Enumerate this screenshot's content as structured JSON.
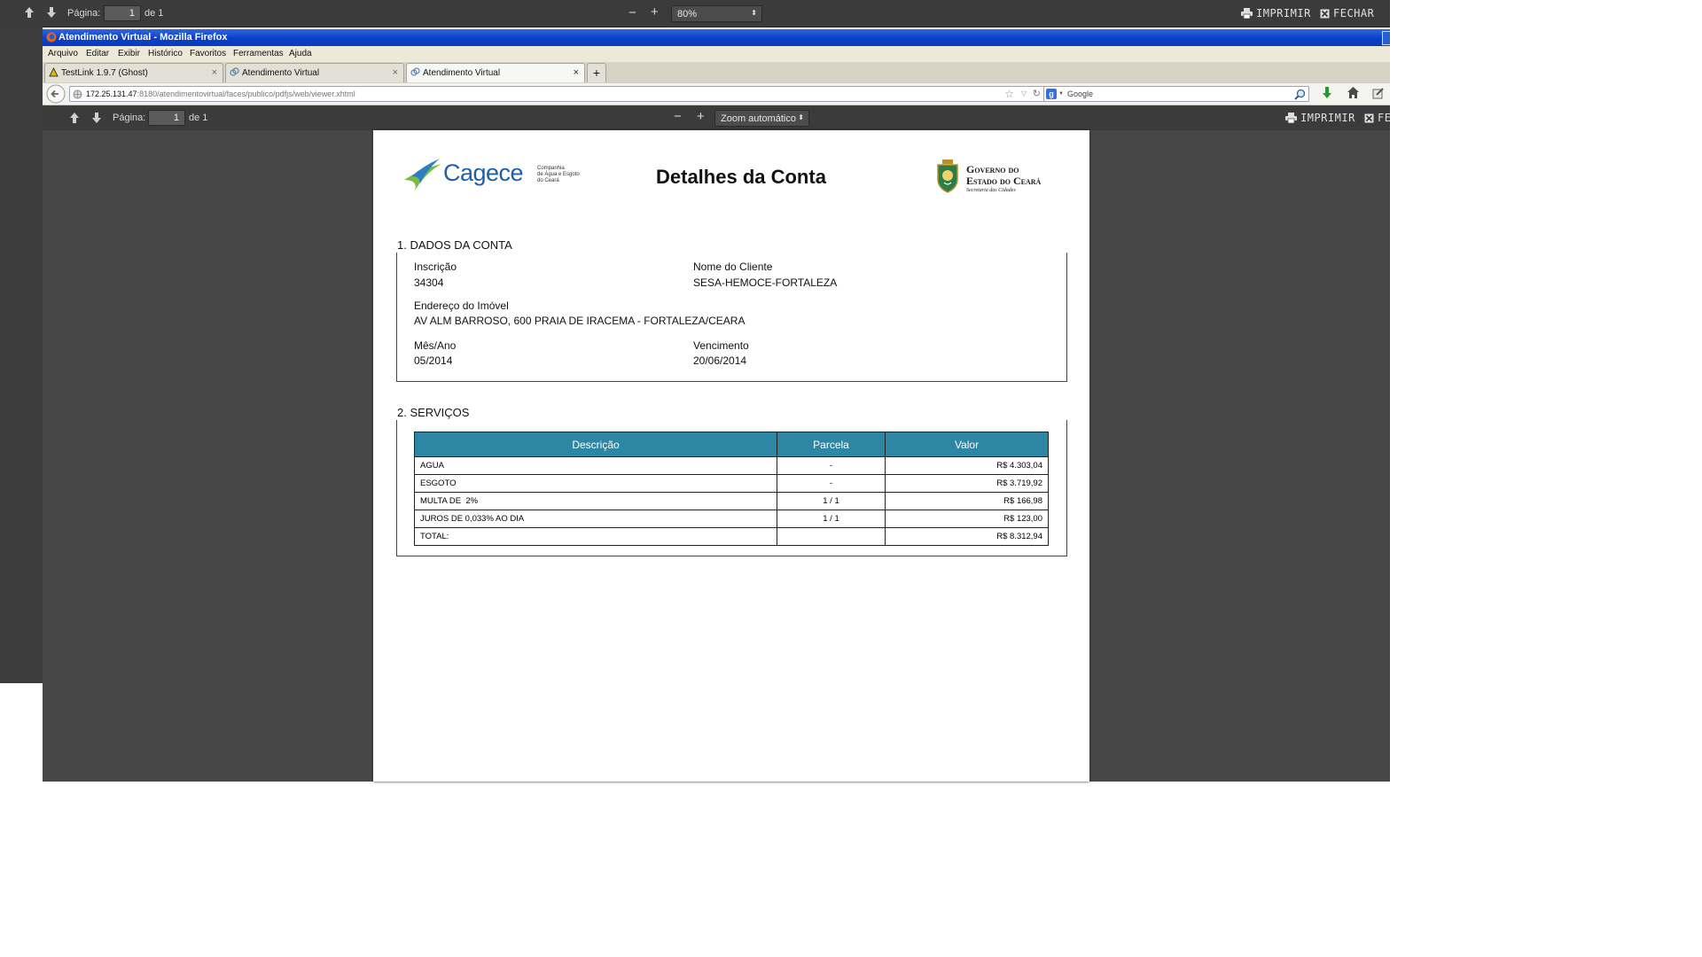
{
  "outer_toolbar": {
    "page_label": "Página:",
    "page_value": "1",
    "page_of": "de 1",
    "zoom_value": "80%",
    "print_label": "IMPRIMIR",
    "close_label": "FECHAR"
  },
  "firefox": {
    "window_title": "Atendimento Virtual - Mozilla Firefox",
    "menu": [
      "Arquivo",
      "Editar",
      "Exibir",
      "Histórico",
      "Favoritos",
      "Ferramentas",
      "Ajuda"
    ],
    "tabs": [
      {
        "label": "TestLink 1.9.7 (Ghost)"
      },
      {
        "label": "Atendimento Virtual"
      },
      {
        "label": "Atendimento Virtual"
      }
    ],
    "new_tab": "+",
    "url_host": "172.25.131.47",
    "url_path": ":8180/atendimentovirtual/faces/publico/pdfjs/web/viewer.xhtml",
    "search_placeholder": "Google"
  },
  "inner_toolbar": {
    "page_label": "Página:",
    "page_value": "1",
    "page_of": "de 1",
    "zoom_value": "Zoom automático",
    "print_label": "IMPRIMIR",
    "close_label": "FE"
  },
  "document": {
    "logo_left_name": "Cagece",
    "logo_left_tagline": [
      "Companhia",
      "de Água e Esgoto",
      "do Ceará"
    ],
    "title": "Detalhes da Conta",
    "logo_right_lines": [
      "Governo do",
      "Estado do Ceará",
      "Secretaria das Cidades"
    ],
    "section1_title": "1. DADOS DA CONTA",
    "inscricao_label": "Inscrição",
    "inscricao_value": "34304",
    "cliente_label": "Nome do Cliente",
    "cliente_value": "SESA-HEMOCE-FORTALEZA",
    "endereco_label": "Endereço do Imóvel",
    "endereco_value": "AV ALM BARROSO, 600 PRAIA DE IRACEMA - FORTALEZA/CEARA",
    "mesano_label": "Mês/Ano",
    "mesano_value": "05/2014",
    "vencimento_label": "Vencimento",
    "vencimento_value": "20/06/2014",
    "section2_title": "2. SERVIÇOS",
    "table_headers": [
      "Descrição",
      "Parcela",
      "Valor"
    ],
    "table_rows": [
      {
        "descricao": "AGUA",
        "parcela": "-",
        "valor": "R$ 4.303,04"
      },
      {
        "descricao": "ESGOTO",
        "parcela": "-",
        "valor": "R$ 3.719,92"
      },
      {
        "descricao": "MULTA DE  2%",
        "parcela": "1 / 1",
        "valor": "R$ 166,98"
      },
      {
        "descricao": "JUROS DE 0,033% AO DIA",
        "parcela": "1 / 1",
        "valor": "R$ 123,00"
      },
      {
        "descricao": "TOTAL:",
        "parcela": "",
        "valor": "R$ 8.312,94"
      }
    ]
  },
  "colors": {
    "toolbar_bg": "#3b3b3b",
    "viewer_bg": "#474747",
    "table_header_bg": "#2e86a5",
    "firefox_titlebar": "#0a3fc8"
  }
}
